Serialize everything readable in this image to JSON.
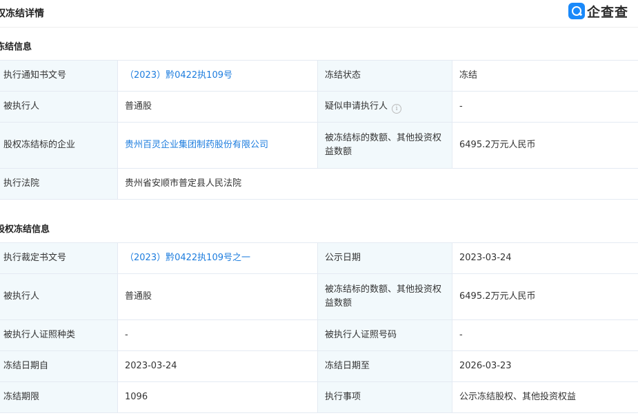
{
  "header": {
    "title": "权冻结详情",
    "logo_text": "企查查"
  },
  "section1": {
    "title": "冻结信息",
    "rows": [
      {
        "l1": "执行通知书文号",
        "v1": "（2023）黔0422执109号",
        "l2": "冻结状态",
        "v2": "冻结"
      },
      {
        "l1": "被执行人",
        "v1": "普通股",
        "l2": "疑似申请执行人",
        "v2": "-"
      },
      {
        "l1": "股权冻结标的企业",
        "v1": "贵州百灵企业集团制药股份有限公司",
        "l2": "被冻结标的数额、其他投资权益数额",
        "v2": "6495.2万元人民币"
      },
      {
        "l1": "执行法院",
        "v1": "贵州省安顺市普定县人民法院"
      }
    ]
  },
  "section2": {
    "title": "股权冻结信息",
    "rows": [
      {
        "l1": "执行裁定书文号",
        "v1": "（2023）黔0422执109号之一",
        "l2": "公示日期",
        "v2": "2023-03-24"
      },
      {
        "l1": "被执行人",
        "v1": "普通股",
        "l2": "被冻结标的数额、其他投资权益数额",
        "v2": "6495.2万元人民币"
      },
      {
        "l1": "被执行人证照种类",
        "v1": "-",
        "l2": "被执行人证照号码",
        "v2": "-"
      },
      {
        "l1": "冻结日期自",
        "v1": "2023-03-24",
        "l2": "冻结日期至",
        "v2": "2026-03-23"
      },
      {
        "l1": "冻结期限",
        "v1": "1096",
        "l2": "执行事项",
        "v2": "公示冻结股权、其他投资权益"
      }
    ]
  },
  "icons": {
    "info": "info-circle-icon",
    "logo": "qichacha-logo-icon"
  }
}
